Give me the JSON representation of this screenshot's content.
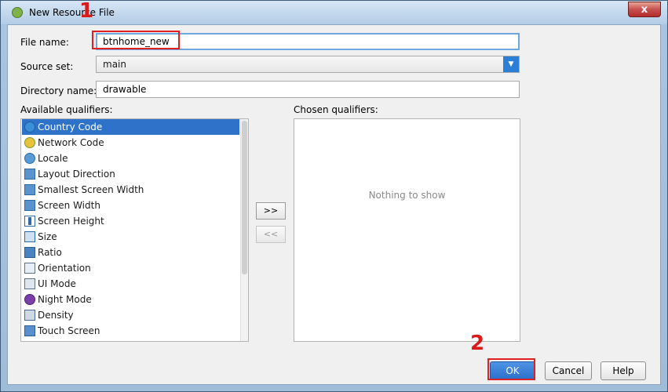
{
  "window": {
    "title": "New Resource File",
    "close_glyph": "x"
  },
  "form": {
    "file_name_label": "File name:",
    "file_name_value": "btnhome_new",
    "source_set_label": "Source set:",
    "source_set_value": "main",
    "directory_name_label": "Directory name:",
    "directory_name_value": "drawable"
  },
  "qualifiers": {
    "available_label": "Available qualifiers:",
    "chosen_label": "Chosen qualifiers:",
    "available": [
      {
        "label": "Country Code",
        "icon": "globe-icon"
      },
      {
        "label": "Network Code",
        "icon": "network-icon"
      },
      {
        "label": "Locale",
        "icon": "locale-icon"
      },
      {
        "label": "Layout Direction",
        "icon": "layout-direction-icon"
      },
      {
        "label": "Smallest Screen Width",
        "icon": "smallest-width-icon"
      },
      {
        "label": "Screen Width",
        "icon": "screen-width-icon"
      },
      {
        "label": "Screen Height",
        "icon": "screen-height-icon"
      },
      {
        "label": "Size",
        "icon": "size-icon"
      },
      {
        "label": "Ratio",
        "icon": "ratio-icon"
      },
      {
        "label": "Orientation",
        "icon": "orientation-icon"
      },
      {
        "label": "UI Mode",
        "icon": "ui-mode-icon"
      },
      {
        "label": "Night Mode",
        "icon": "night-mode-icon"
      },
      {
        "label": "Density",
        "icon": "density-icon"
      },
      {
        "label": "Touch Screen",
        "icon": "touch-screen-icon"
      }
    ],
    "selected_index": 0,
    "add_label": ">>",
    "remove_label": "<<",
    "empty_text": "Nothing to show"
  },
  "buttons": {
    "ok": "OK",
    "cancel": "Cancel",
    "help": "Help"
  },
  "annotations": {
    "marker_1": "1",
    "marker_2": "2",
    "color": "#e02020"
  }
}
